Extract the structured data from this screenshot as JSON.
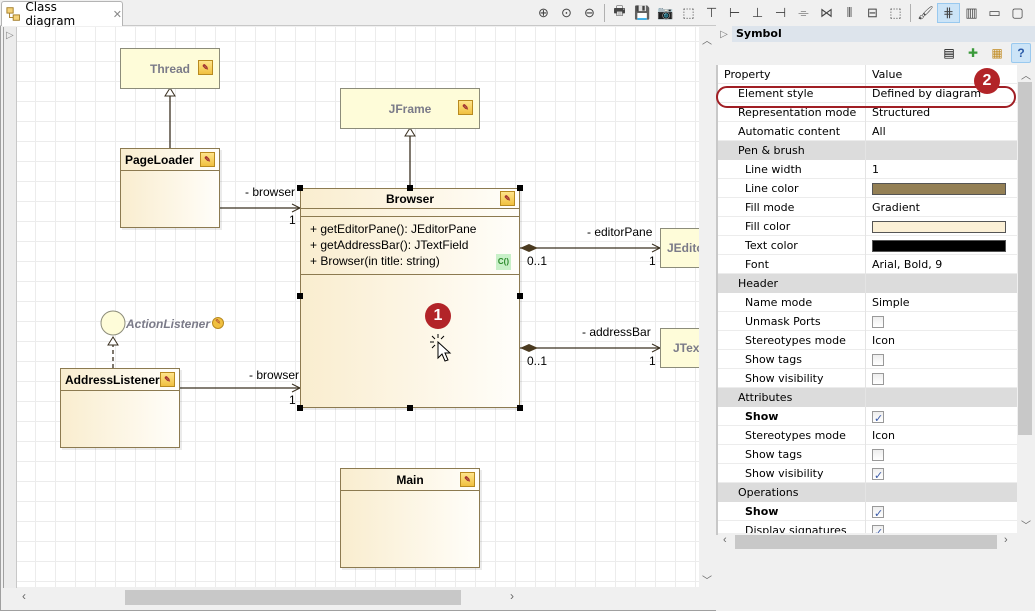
{
  "editor_tab": {
    "icon": "class-diagram-icon",
    "label": "Class diagram",
    "close_icon": "close-icon"
  },
  "toolbar": {
    "groups": [
      [
        "zoom-in-icon",
        "zoom-reset-icon",
        "zoom-out-icon"
      ],
      [
        "print-icon",
        "save-icon",
        "snapshot-icon",
        "select-region-icon",
        "align-top-icon",
        "align-left-icon",
        "align-bottom-icon",
        "align-right-icon",
        "center-horizontal-icon",
        "center-vertical-icon",
        "distribute-horizontal-icon",
        "distribute-vertical-icon",
        "fit-icon"
      ],
      [
        "format-painter-icon",
        "grid-icon",
        "panel-icon",
        "minimize-icon",
        "maximize-icon"
      ]
    ],
    "glyphs": [
      "⊕",
      "⊙",
      "⊖",
      "🖶",
      "💾",
      "📷",
      "⬚",
      "⊤",
      "⊢",
      "⊥",
      "⊣",
      "⌯",
      "⋈",
      "⫴",
      "⊟",
      "⬚",
      "🖌",
      "⋕",
      "▥",
      "▭",
      "▢"
    ],
    "selected": "grid-icon"
  },
  "diagram": {
    "classes": {
      "thread": "Thread",
      "jframe": "JFrame",
      "pageloader": "PageLoader",
      "browser": "Browser",
      "jeditor": "JEdito",
      "jtext": "JTex",
      "actionlistener": "ActionListener",
      "addresslistener": "AddressListener",
      "main": "Main"
    },
    "browser_operations": [
      "+ getEditorPane(): JEditorPane",
      "+ getAddressBar(): JTextField",
      "+ Browser(in title: string)"
    ],
    "constructor_tag": "C()",
    "associations": {
      "pageloader_role": "- browser",
      "pageloader_mult": "1",
      "editor_role": "- editorPane",
      "editor_src_mult": "0..1",
      "editor_dst_mult": "1",
      "address_role": "- addressBar",
      "address_src_mult": "0..1",
      "address_dst_mult": "1",
      "listener_role": "- browser",
      "listener_mult": "1"
    },
    "callout_1": "1"
  },
  "properties_panel": {
    "title": "Symbol",
    "tools": [
      "reset-style-icon",
      "add-style-icon",
      "apply-style-icon",
      "help-icon"
    ],
    "columns": {
      "property": "Property",
      "value": "Value"
    },
    "callout_2": "2",
    "rows": [
      {
        "key": "Element style",
        "value": "Defined by diagram",
        "type": "text",
        "level": 1
      },
      {
        "key": "Representation mode",
        "value": "Structured",
        "type": "text",
        "level": 1
      },
      {
        "key": "Automatic content",
        "value": "All",
        "type": "text",
        "level": 1
      },
      {
        "key": "Pen & brush",
        "type": "group"
      },
      {
        "key": "Line width",
        "value": "1",
        "type": "text",
        "level": 2
      },
      {
        "key": "Line color",
        "color": "#948055",
        "type": "color",
        "level": 2
      },
      {
        "key": "Fill mode",
        "value": "Gradient",
        "type": "text",
        "level": 2
      },
      {
        "key": "Fill color",
        "color": "#fbf0d6",
        "type": "color",
        "level": 2
      },
      {
        "key": "Text color",
        "color": "#000000",
        "type": "color",
        "level": 2
      },
      {
        "key": "Font",
        "value": "Arial, Bold, 9",
        "type": "text",
        "level": 2
      },
      {
        "key": "Header",
        "type": "group"
      },
      {
        "key": "Name mode",
        "value": "Simple",
        "type": "text",
        "level": 2
      },
      {
        "key": "Unmask Ports",
        "checked": false,
        "type": "check",
        "level": 2
      },
      {
        "key": "Stereotypes mode",
        "value": "Icon",
        "type": "text",
        "level": 2
      },
      {
        "key": "Show tags",
        "checked": false,
        "type": "check",
        "level": 2
      },
      {
        "key": "Show visibility",
        "checked": false,
        "type": "check",
        "level": 2
      },
      {
        "key": "Attributes",
        "type": "group"
      },
      {
        "key": "Show",
        "checked": true,
        "type": "check",
        "level": 2,
        "bold": true
      },
      {
        "key": "Stereotypes mode",
        "value": "Icon",
        "type": "text",
        "level": 2
      },
      {
        "key": "Show tags",
        "checked": false,
        "type": "check",
        "level": 2
      },
      {
        "key": "Show visibility",
        "checked": true,
        "type": "check",
        "level": 2
      },
      {
        "key": "Operations",
        "type": "group"
      },
      {
        "key": "Show",
        "checked": true,
        "type": "check",
        "level": 2,
        "bold": true
      },
      {
        "key": "Display signatures",
        "checked": true,
        "type": "check",
        "level": 2
      }
    ]
  }
}
